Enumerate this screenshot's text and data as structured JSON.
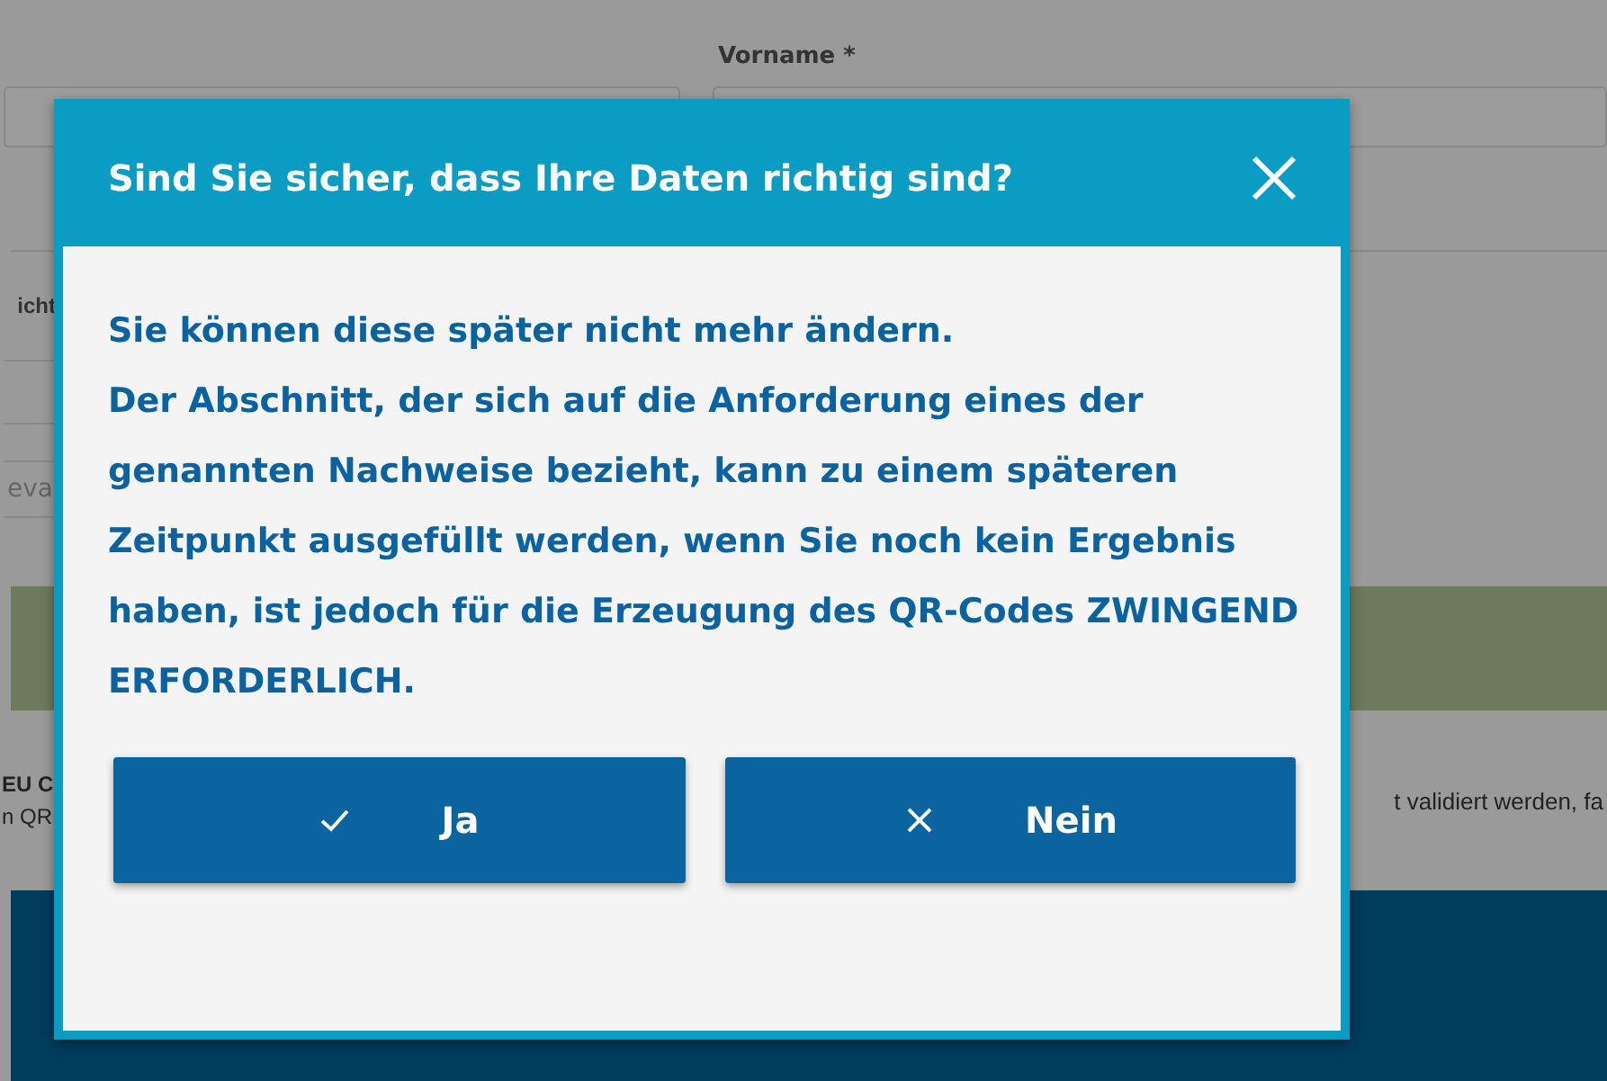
{
  "background_form": {
    "first_name_label": "Vorname *",
    "label_fragment": "icht",
    "placeholder_fragment": "eva",
    "notice_left": [
      "EU C",
      "n QR"
    ],
    "notice_right": "t validiert werden, fa"
  },
  "dialog": {
    "title": "Sind Sie sicher, dass Ihre Daten richtig sind?",
    "message": [
      "Sie können diese später nicht mehr ändern.",
      "Der Abschnitt, der sich auf die Anforderung eines der genannten Nachweise bezieht, kann zu einem späteren Zeitpunkt ausgefüllt werden, wenn Sie noch kein Ergebnis haben, ist jedoch für die Erzeugung des QR-Codes ZWINGEND ERFORDERLICH."
    ],
    "buttons": [
      {
        "label": "Ja",
        "kind": "confirm"
      },
      {
        "label": "Nein",
        "kind": "cancel"
      }
    ]
  }
}
